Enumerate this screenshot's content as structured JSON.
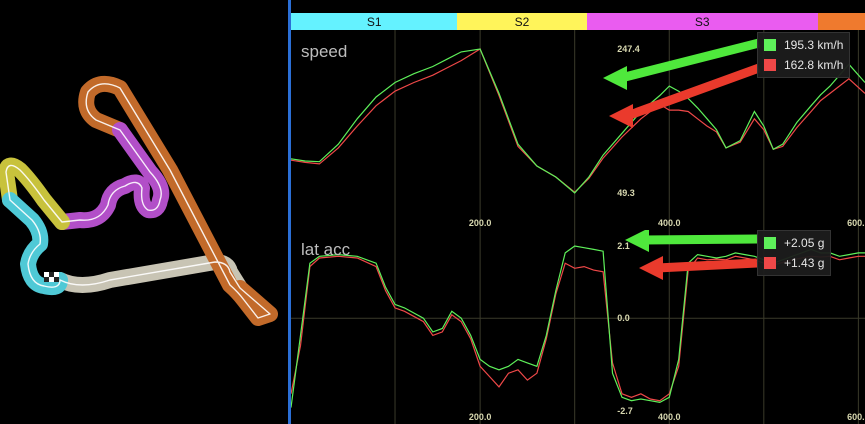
{
  "colors": {
    "lap_a": "#5ef05a",
    "lap_b": "#ef4848",
    "background": "#000000",
    "grid": "#3a3a2a",
    "divider": "#2b6fd6",
    "arrow_green": "#4fe83c",
    "arrow_red": "#ea3a2c"
  },
  "sectors": [
    {
      "label": "S1",
      "color": "#64f2ff",
      "from": 0,
      "to": 0.29
    },
    {
      "label": "S2",
      "color": "#fff45a",
      "from": 0.29,
      "to": 0.515
    },
    {
      "label": "S3",
      "color": "#ea5cf0",
      "from": 0.515,
      "to": 0.918
    },
    {
      "label": "",
      "color": "#ef7a2e",
      "from": 0.918,
      "to": 1
    }
  ],
  "track_map": {
    "sector_colors": [
      "#4fc9d6",
      "#c8c23c",
      "#b24fc8",
      "#c26a2a",
      "#c8c4b4"
    ],
    "flag_icon": "checkered-flag-icon"
  },
  "speed": {
    "label": "speed",
    "max_label": "247.4",
    "min_label": "49.3",
    "ylim": [
      49.3,
      247.4
    ],
    "legend": {
      "a": "195.3 km/h",
      "b": "162.8 km/h"
    },
    "x_ticks": [
      "200.0",
      "400.0",
      "600.0"
    ]
  },
  "lat_acc": {
    "label": "lat acc",
    "max_label": "2.1",
    "zero_label": "0.0",
    "min_label": "-2.7",
    "ylim": [
      -2.7,
      2.1
    ],
    "legend": {
      "a": "+2.05 g",
      "b": "+1.43 g"
    },
    "x_ticks": [
      "200.0",
      "400.0",
      "600.0"
    ]
  },
  "chart_data": [
    {
      "type": "line",
      "title": "speed",
      "xlabel": "",
      "ylabel": "",
      "xlim": [
        0,
        607
      ],
      "ylim": [
        49.3,
        247.4
      ],
      "x_ticks": [
        200,
        400,
        600
      ],
      "grid": true,
      "series": [
        {
          "values_x": [
            0,
            15,
            30,
            50,
            70,
            90,
            110,
            130,
            150,
            165,
            180,
            200,
            220,
            240,
            260,
            280,
            300,
            315,
            330,
            350,
            370,
            390,
            400,
            410,
            420,
            430,
            440,
            450,
            460,
            475,
            490,
            500,
            510,
            520,
            535,
            550,
            560,
            570,
            590,
            607
          ],
          "values": [
            95,
            92,
            91,
            115,
            150,
            180,
            200,
            212,
            222,
            232,
            242,
            246,
            185,
            115,
            85,
            70,
            48,
            70,
            100,
            130,
            160,
            182,
            195,
            188,
            178,
            165,
            150,
            135,
            110,
            120,
            160,
            140,
            108,
            115,
            145,
            168,
            183,
            195,
            225,
            200
          ]
        },
        {
          "values_x": [
            0,
            15,
            30,
            50,
            70,
            90,
            110,
            130,
            150,
            165,
            180,
            200,
            220,
            240,
            260,
            280,
            300,
            315,
            330,
            350,
            370,
            390,
            400,
            410,
            420,
            430,
            440,
            450,
            460,
            475,
            490,
            500,
            510,
            520,
            535,
            550,
            560,
            570,
            590,
            607
          ],
          "values": [
            93,
            90,
            88,
            110,
            140,
            168,
            188,
            200,
            210,
            220,
            230,
            246,
            182,
            112,
            85,
            70,
            49,
            68,
            96,
            125,
            150,
            170,
            162,
            162,
            160,
            150,
            140,
            132,
            110,
            118,
            150,
            135,
            108,
            112,
            138,
            160,
            175,
            185,
            205,
            185
          ]
        }
      ]
    },
    {
      "type": "line",
      "title": "lat acc",
      "xlabel": "",
      "ylabel": "",
      "xlim": [
        0,
        607
      ],
      "ylim": [
        -2.7,
        2.1
      ],
      "x_ticks": [
        200,
        400,
        600
      ],
      "grid": true,
      "series": [
        {
          "values_x": [
            0,
            10,
            20,
            30,
            50,
            70,
            90,
            100,
            110,
            120,
            140,
            150,
            160,
            170,
            180,
            190,
            200,
            210,
            220,
            230,
            240,
            250,
            260,
            270,
            280,
            290,
            300,
            310,
            320,
            330,
            340,
            350,
            360,
            370,
            380,
            390,
            400,
            410,
            420,
            430,
            440,
            450,
            460,
            470,
            480,
            490,
            500,
            510,
            520,
            530,
            540,
            550,
            560,
            570,
            580,
            590,
            600,
            607
          ],
          "values": [
            -2.6,
            -0.5,
            1.6,
            1.8,
            1.85,
            1.8,
            1.6,
            0.9,
            0.4,
            0.3,
            0.0,
            -0.4,
            -0.3,
            0.2,
            0.0,
            -0.5,
            -1.2,
            -1.4,
            -1.5,
            -1.4,
            -1.2,
            -1.3,
            -1.4,
            -0.5,
            0.8,
            1.9,
            2.1,
            2.05,
            2.0,
            1.95,
            -1.6,
            -2.3,
            -2.4,
            -2.35,
            -2.4,
            -2.45,
            -2.3,
            -1.2,
            1.6,
            1.85,
            1.8,
            1.75,
            1.8,
            1.9,
            1.85,
            1.8,
            1.7,
            1.6,
            1.7,
            1.8,
            1.9,
            2.0,
            1.9,
            1.9,
            1.8,
            1.85,
            1.9,
            1.9
          ]
        },
        {
          "values_x": [
            0,
            10,
            20,
            30,
            50,
            70,
            90,
            100,
            110,
            120,
            140,
            150,
            160,
            170,
            180,
            190,
            200,
            210,
            220,
            230,
            240,
            250,
            260,
            270,
            280,
            290,
            300,
            310,
            320,
            330,
            340,
            350,
            360,
            370,
            380,
            390,
            400,
            410,
            420,
            430,
            440,
            450,
            460,
            470,
            480,
            490,
            500,
            510,
            520,
            530,
            540,
            550,
            560,
            570,
            580,
            590,
            600,
            607
          ],
          "values": [
            -2.2,
            -0.8,
            1.5,
            1.75,
            1.8,
            1.75,
            1.5,
            0.8,
            0.3,
            0.2,
            -0.1,
            -0.5,
            -0.4,
            0.1,
            -0.1,
            -0.6,
            -1.4,
            -1.7,
            -2.0,
            -1.6,
            -1.5,
            -1.8,
            -1.6,
            -0.6,
            0.7,
            1.6,
            1.45,
            1.5,
            1.4,
            1.35,
            -1.3,
            -2.2,
            -2.3,
            -2.2,
            -2.35,
            -2.4,
            -2.2,
            -1.4,
            1.4,
            1.75,
            1.7,
            1.72,
            1.7,
            1.8,
            1.75,
            1.7,
            1.6,
            1.55,
            1.62,
            1.7,
            1.75,
            1.8,
            1.78,
            1.8,
            1.7,
            1.75,
            1.8,
            1.8
          ]
        }
      ]
    }
  ]
}
